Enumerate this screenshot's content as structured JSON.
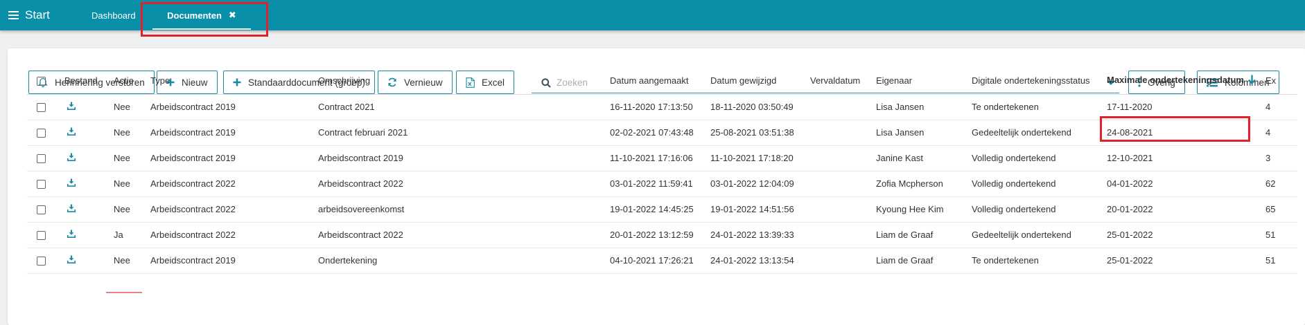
{
  "topbar": {
    "start_label": "Start",
    "tabs": [
      {
        "label": "Dashboard"
      },
      {
        "label": "Documenten",
        "close": "✖"
      }
    ]
  },
  "toolbar": {
    "reminder_label": "Herinnering versturen",
    "new_label": "Nieuw",
    "standard_label": "Standaarddocument (groep)",
    "refresh_label": "Vernieuw",
    "excel_label": "Excel",
    "search_placeholder": "Zoeken",
    "more_label": "Overig",
    "columns_label": "Kolommen"
  },
  "table": {
    "headers": [
      "Bestand",
      "Actie",
      "Type",
      "Omschrijving",
      "Datum aangemaakt",
      "Datum gewijzigd",
      "Vervaldatum",
      "Eigenaar",
      "Digitale ondertekeningsstatus",
      "Maximale ondertekeningsdatum",
      "Ex"
    ],
    "rows": [
      {
        "actie": "Nee",
        "type": "Arbeidscontract 2019",
        "omschrijving": "Contract 2021",
        "aangemaakt": "16-11-2020 17:13:50",
        "gewijzigd": "18-11-2020 03:50:49",
        "verval": "",
        "eigenaar": "Lisa Jansen",
        "status": "Te ondertekenen",
        "max": "17-11-2020",
        "ex": "4"
      },
      {
        "actie": "Nee",
        "type": "Arbeidscontract 2019",
        "omschrijving": "Contract februari 2021",
        "aangemaakt": "02-02-2021 07:43:48",
        "gewijzigd": "25-08-2021 03:51:38",
        "verval": "",
        "eigenaar": "Lisa Jansen",
        "status": "Gedeeltelijk ondertekend",
        "max": "24-08-2021",
        "ex": "4"
      },
      {
        "actie": "Nee",
        "type": "Arbeidscontract 2019",
        "omschrijving": "Arbeidscontract 2019",
        "aangemaakt": "11-10-2021 17:16:06",
        "gewijzigd": "11-10-2021 17:18:20",
        "verval": "",
        "eigenaar": "Janine Kast",
        "status": "Volledig ondertekend",
        "max": "12-10-2021",
        "ex": "3"
      },
      {
        "actie": "Nee",
        "type": "Arbeidscontract 2022",
        "omschrijving": "Arbeidscontract 2022",
        "aangemaakt": "03-01-2022 11:59:41",
        "gewijzigd": "03-01-2022 12:04:09",
        "verval": "",
        "eigenaar": "Zofia Mcpherson",
        "status": "Volledig ondertekend",
        "max": "04-01-2022",
        "ex": "62"
      },
      {
        "actie": "Nee",
        "type": "Arbeidscontract 2022",
        "omschrijving": "arbeidsovereenkomst",
        "aangemaakt": "19-01-2022 14:45:25",
        "gewijzigd": "19-01-2022 14:51:56",
        "verval": "",
        "eigenaar": "Kyoung Hee Kim",
        "status": "Volledig ondertekend",
        "max": "20-01-2022",
        "ex": "65"
      },
      {
        "actie": "Ja",
        "type": "Arbeidscontract 2022",
        "omschrijving": "Arbeidscontract 2022",
        "aangemaakt": "20-01-2022 13:12:59",
        "gewijzigd": "24-01-2022 13:39:33",
        "verval": "",
        "eigenaar": "Liam de Graaf",
        "status": "Gedeeltelijk ondertekend",
        "max": "25-01-2022",
        "ex": "51"
      },
      {
        "actie": "Nee",
        "type": "Arbeidscontract 2019",
        "omschrijving": "Ondertekening",
        "aangemaakt": "04-10-2021 17:26:21",
        "gewijzigd": "24-01-2022 13:13:54",
        "verval": "",
        "eigenaar": "Liam de Graaf",
        "status": "Te ondertekenen",
        "max": "25-01-2022",
        "ex": "51"
      }
    ]
  },
  "colors": {
    "brand": "#0a8fa9",
    "accent": "#1a8aa5",
    "highlight": "#e5202b"
  }
}
